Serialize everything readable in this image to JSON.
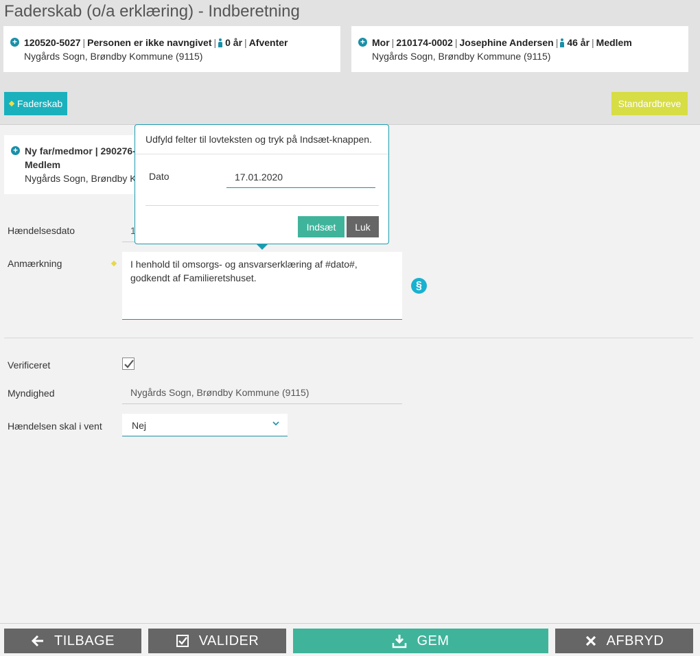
{
  "page": {
    "title": "Faderskab (o/a erklæring) - Indberetning"
  },
  "child_card": {
    "id": "120520-5027",
    "name": "Personen er ikke navngivet",
    "age": "0 år",
    "status": "Afventer",
    "location": "Nygårds Sogn, Brøndby Kommune (9115)"
  },
  "mother_card": {
    "role": "Mor",
    "id_prefix": "210174-",
    "id_suffix": "0002",
    "name": "Josephine Andersen",
    "age": "46 år",
    "status": "Medlem",
    "location": "Nygårds Sogn, Brøndby Kommune (9115)"
  },
  "toolbar": {
    "faderskab_label": "Faderskab",
    "standardbreve_label": "Standardbreve"
  },
  "new_father_card": {
    "line1": "Ny far/medmor | 290276-",
    "line2": "Medlem",
    "location": "Nygårds Sogn, Brøndby K"
  },
  "form": {
    "haendelsesdato_label": "Hændelsesdato",
    "haendelsesdato_value_fragment": "1",
    "anmaerkning_label": "Anmærkning",
    "anmaerkning_line1": "I henhold til omsorgs- og ansvarserklæring af #dato#,",
    "anmaerkning_line2": "godkendt af Familieretshuset.",
    "paragraph_symbol": "§",
    "verificeret_label": "Verificeret",
    "verificeret_checked": true,
    "myndighed_label": "Myndighed",
    "myndighed_value": "Nygårds Sogn, Brøndby Kommune (9115)",
    "vent_label": "Hændelsen skal i vent",
    "vent_value": "Nej"
  },
  "popover": {
    "title": "Udfyld felter til lovteksten og tryk på Indsæt-knappen.",
    "date_label": "Dato",
    "date_value": "17.01.2020",
    "insert_label": "Indsæt",
    "close_label": "Luk"
  },
  "footer": {
    "back_label": "TILBAGE",
    "validate_label": "VALIDER",
    "save_label": "GEM",
    "cancel_label": "AFBRYD"
  },
  "colors": {
    "teal": "#1ab1bd",
    "green": "#3fb49b",
    "yellow": "#d7dd44",
    "gray_button": "#666666"
  }
}
